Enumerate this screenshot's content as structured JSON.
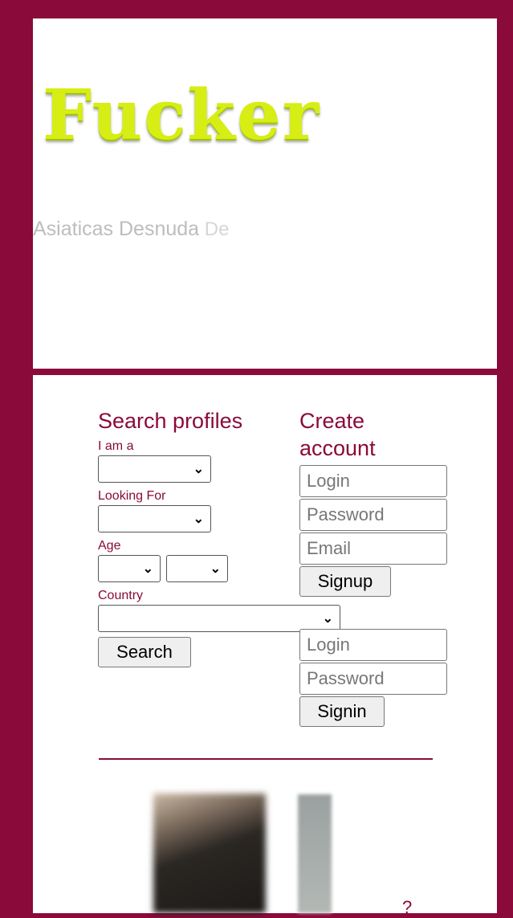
{
  "header": {
    "logo_text": "Fucker",
    "tagline_part1": "Asiaticas Desnuda",
    "tagline_part2": "De"
  },
  "search": {
    "title": "Search profiles",
    "i_am_label": "I am a",
    "looking_for_label": "Looking For",
    "age_label": "Age",
    "country_label": "Country",
    "search_button": "Search"
  },
  "signup": {
    "title_line1": "Create",
    "title_line2": "account",
    "login_placeholder": "Login",
    "password_placeholder": "Password",
    "email_placeholder": "Email",
    "signup_button": "Signup"
  },
  "signin": {
    "login_placeholder": "Login",
    "password_placeholder": "Password",
    "signin_button": "Signin"
  },
  "icons": {
    "dropdown": "chevron-down-icon"
  },
  "colors": {
    "brand": "#8a0a3a",
    "logo": "#d7ee14"
  }
}
